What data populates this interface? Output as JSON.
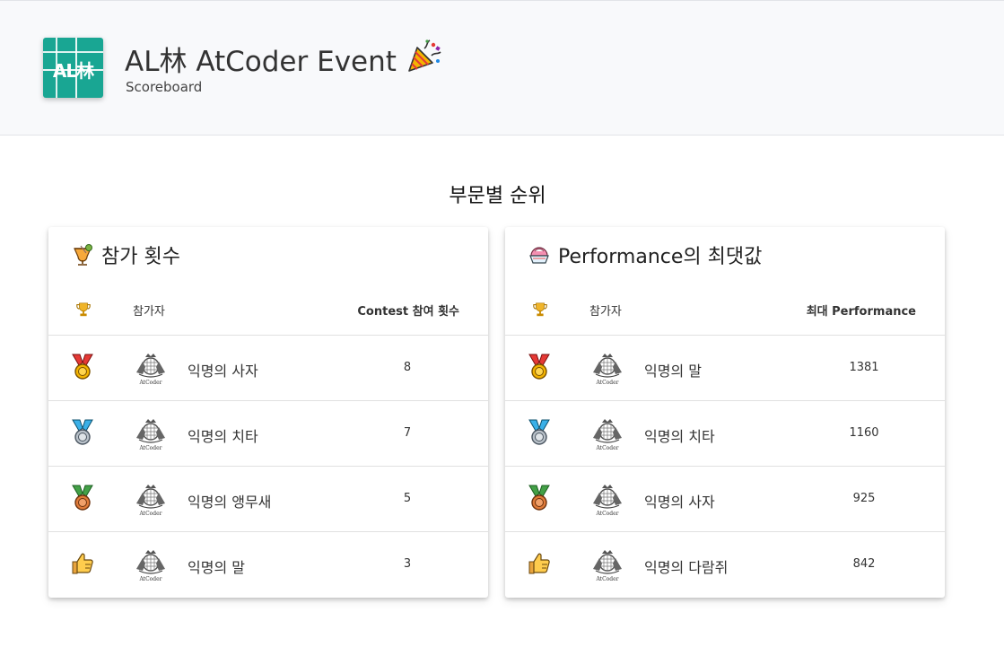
{
  "header": {
    "title": "AL林 AtCoder Event",
    "subtitle": "Scoreboard",
    "logo_text": "AL林",
    "logo_icon": "al-logo",
    "party_icon": "party-popper-icon"
  },
  "section": {
    "title": "부문별 순위"
  },
  "cards": [
    {
      "title": "참가 횟수",
      "title_icon": "cocktail-icon",
      "head": {
        "name_label": "참가자",
        "value_label": "Contest 참여 횟수"
      },
      "rows": [
        {
          "rank_icon": "gold-medal-icon",
          "name": "익명의 사자",
          "value": "8"
        },
        {
          "rank_icon": "silver-medal-icon",
          "name": "익명의 치타",
          "value": "7"
        },
        {
          "rank_icon": "bronze-medal-icon",
          "name": "익명의 앵무새",
          "value": "5"
        },
        {
          "rank_icon": "thumbs-up-icon",
          "name": "익명의 말",
          "value": "3"
        }
      ]
    },
    {
      "title": "Performance의 최댓값",
      "title_icon": "shaved-ice-icon",
      "head": {
        "name_label": "참가자",
        "value_label": "최대 Performance"
      },
      "rows": [
        {
          "rank_icon": "gold-medal-icon",
          "name": "익명의 말",
          "value": "1381"
        },
        {
          "rank_icon": "silver-medal-icon",
          "name": "익명의 치타",
          "value": "1160"
        },
        {
          "rank_icon": "bronze-medal-icon",
          "name": "익명의 사자",
          "value": "925"
        },
        {
          "rank_icon": "thumbs-up-icon",
          "name": "익명의 다람쥐",
          "value": "842"
        }
      ]
    }
  ],
  "colors": {
    "logo_bg": "#19a693",
    "header_bg": "#f8f9fb",
    "gold": "#f4b400",
    "silver": "#b9c1c9",
    "bronze": "#e07b39"
  }
}
